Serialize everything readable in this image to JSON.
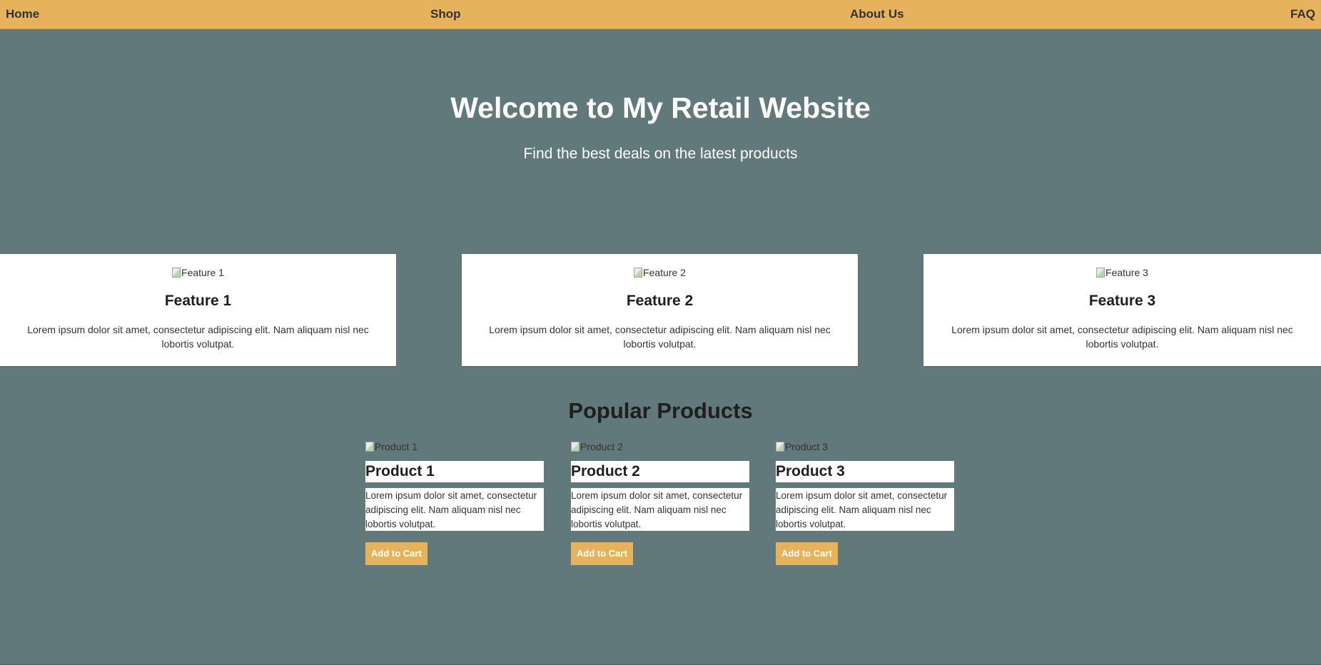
{
  "nav": {
    "home": "Home",
    "shop": "Shop",
    "about": "About Us",
    "faq": "FAQ"
  },
  "hero": {
    "title": "Welcome to My Retail Website",
    "subtitle": "Find the best deals on the latest products"
  },
  "features": [
    {
      "image_alt": "Feature 1",
      "title": "Feature 1",
      "text": "Lorem ipsum dolor sit amet, consectetur adipiscing elit. Nam aliquam nisl nec lobortis volutpat."
    },
    {
      "image_alt": "Feature 2",
      "title": "Feature 2",
      "text": "Lorem ipsum dolor sit amet, consectetur adipiscing elit. Nam aliquam nisl nec lobortis volutpat."
    },
    {
      "image_alt": "Feature 3",
      "title": "Feature 3",
      "text": "Lorem ipsum dolor sit amet, consectetur adipiscing elit. Nam aliquam nisl nec lobortis volutpat."
    }
  ],
  "popular": {
    "title": "Popular Products",
    "products": [
      {
        "image_alt": "Product 1",
        "name": "Product 1",
        "description": "Lorem ipsum dolor sit amet, consectetur adipiscing elit. Nam aliquam nisl nec lobortis volutpat.",
        "button": "Add to Cart"
      },
      {
        "image_alt": "Product 2",
        "name": "Product 2",
        "description": "Lorem ipsum dolor sit amet, consectetur adipiscing elit. Nam aliquam nisl nec lobortis volutpat.",
        "button": "Add to Cart"
      },
      {
        "image_alt": "Product 3",
        "name": "Product 3",
        "description": "Lorem ipsum dolor sit amet, consectetur adipiscing elit. Nam aliquam nisl nec lobortis volutpat.",
        "button": "Add to Cart"
      }
    ]
  },
  "colors": {
    "navbar": "#e6b25b",
    "background": "#62797c",
    "card": "#ffffff",
    "button": "#e6b25b"
  },
  "icons": {
    "broken_image": "broken-image-icon"
  }
}
